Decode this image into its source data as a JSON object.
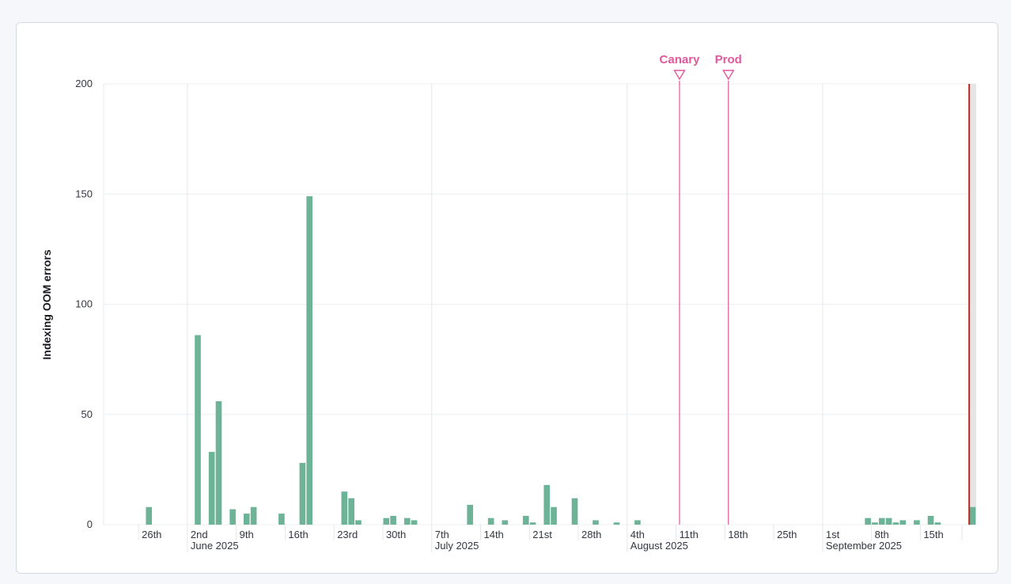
{
  "chart_data": {
    "type": "bar",
    "title": "",
    "xlabel": "",
    "ylabel": "Indexing OOM errors",
    "ylim": [
      0,
      200
    ],
    "yticks": [
      0,
      50,
      100,
      150,
      200
    ],
    "grid": true,
    "x_domain": [
      "2025-05-21",
      "2025-09-22"
    ],
    "bar_color": "#6db397",
    "annotation_color": "#e2589b",
    "marker_color": "#bd271e",
    "x_ticks": [
      {
        "date": "2025-05-26",
        "label": "26th"
      },
      {
        "date": "2025-06-02",
        "label": "2nd",
        "sub": "June 2025"
      },
      {
        "date": "2025-06-09",
        "label": "9th"
      },
      {
        "date": "2025-06-16",
        "label": "16th"
      },
      {
        "date": "2025-06-23",
        "label": "23rd"
      },
      {
        "date": "2025-06-30",
        "label": "30th"
      },
      {
        "date": "2025-07-07",
        "label": "7th",
        "sub": "July 2025"
      },
      {
        "date": "2025-07-14",
        "label": "14th"
      },
      {
        "date": "2025-07-21",
        "label": "21st"
      },
      {
        "date": "2025-07-28",
        "label": "28th"
      },
      {
        "date": "2025-08-04",
        "label": "4th",
        "sub": "August 2025"
      },
      {
        "date": "2025-08-11",
        "label": "11th"
      },
      {
        "date": "2025-08-18",
        "label": "18th"
      },
      {
        "date": "2025-08-25",
        "label": "25th"
      },
      {
        "date": "2025-09-01",
        "label": "1st",
        "sub": "September 2025"
      },
      {
        "date": "2025-09-08",
        "label": "8th"
      },
      {
        "date": "2025-09-15",
        "label": "15th"
      }
    ],
    "series": [
      {
        "values": [
          {
            "x": "2025-05-27",
            "y": 8
          },
          {
            "x": "2025-06-03",
            "y": 86
          },
          {
            "x": "2025-06-05",
            "y": 33
          },
          {
            "x": "2025-06-06",
            "y": 56
          },
          {
            "x": "2025-06-08",
            "y": 7
          },
          {
            "x": "2025-06-10",
            "y": 5
          },
          {
            "x": "2025-06-11",
            "y": 8
          },
          {
            "x": "2025-06-15",
            "y": 5
          },
          {
            "x": "2025-06-18",
            "y": 28
          },
          {
            "x": "2025-06-19",
            "y": 149
          },
          {
            "x": "2025-06-24",
            "y": 15
          },
          {
            "x": "2025-06-25",
            "y": 12
          },
          {
            "x": "2025-06-26",
            "y": 2
          },
          {
            "x": "2025-06-30",
            "y": 3
          },
          {
            "x": "2025-07-01",
            "y": 4
          },
          {
            "x": "2025-07-03",
            "y": 3
          },
          {
            "x": "2025-07-04",
            "y": 2
          },
          {
            "x": "2025-07-12",
            "y": 9
          },
          {
            "x": "2025-07-15",
            "y": 3
          },
          {
            "x": "2025-07-17",
            "y": 2
          },
          {
            "x": "2025-07-20",
            "y": 4
          },
          {
            "x": "2025-07-21",
            "y": 1
          },
          {
            "x": "2025-07-23",
            "y": 18
          },
          {
            "x": "2025-07-24",
            "y": 8
          },
          {
            "x": "2025-07-27",
            "y": 12
          },
          {
            "x": "2025-07-30",
            "y": 2
          },
          {
            "x": "2025-08-02",
            "y": 1
          },
          {
            "x": "2025-08-05",
            "y": 2
          },
          {
            "x": "2025-09-07",
            "y": 3
          },
          {
            "x": "2025-09-08",
            "y": 1
          },
          {
            "x": "2025-09-09",
            "y": 3
          },
          {
            "x": "2025-09-10",
            "y": 3
          },
          {
            "x": "2025-09-11",
            "y": 1
          },
          {
            "x": "2025-09-12",
            "y": 2
          },
          {
            "x": "2025-09-14",
            "y": 2
          },
          {
            "x": "2025-09-16",
            "y": 4
          },
          {
            "x": "2025-09-17",
            "y": 1
          },
          {
            "x": "2025-09-22",
            "y": 8
          }
        ]
      }
    ],
    "annotations": [
      {
        "label": "Canary",
        "date": "2025-08-11"
      },
      {
        "label": "Prod",
        "date": "2025-08-18"
      }
    ],
    "current_time_marker": "2025-09-22"
  }
}
